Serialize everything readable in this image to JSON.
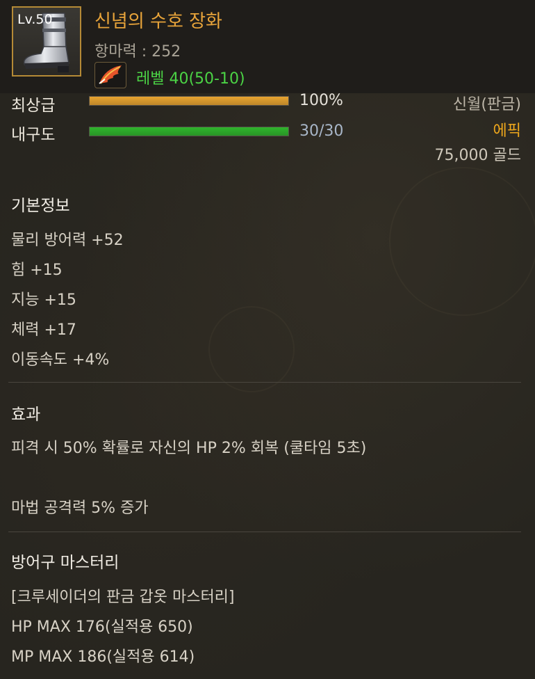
{
  "item": {
    "level_badge": "Lv.50",
    "name": "신념의 수호 장화",
    "resist": "항마력 : 252",
    "required_level": "레벨 40(50-10)",
    "icon": "armored-boots-icon",
    "requirement_icon": "feather-wing-icon"
  },
  "bars": [
    {
      "label": "최상급",
      "value_text": "100%",
      "fill": 1.0,
      "color": "#e8a430",
      "right_text": "신월(판금)",
      "right_color": "#bdb6a8"
    },
    {
      "label": "내구도",
      "value_text": "30/30",
      "fill": 1.0,
      "color": "#2fb52c",
      "right_text": "에픽",
      "right_color": "#f0a81c"
    }
  ],
  "price": "75,000 골드",
  "basic_info": {
    "title": "기본정보",
    "lines": [
      "물리 방어력 +52",
      "힘 +15",
      "지능 +15",
      "체력 +17",
      "이동속도 +4%"
    ]
  },
  "effect": {
    "title": "효과",
    "lines": [
      "피격 시 50% 확률로 자신의 HP 2% 회복 (쿨타임 5초)",
      "마법 공격력 5% 증가"
    ]
  },
  "mastery": {
    "title": "방어구 마스터리",
    "lines": [
      "[크루세이더의 판금 갑옷 마스터리]",
      "HP MAX 176(실적용 650)",
      "MP MAX 186(실적용 614)"
    ]
  },
  "colors": {
    "item_name": "#e8a43a",
    "required_level": "#4bd345",
    "durability_value": "#a8b6c8",
    "grade_value": "#e6e2da",
    "icon_border": "#b58a36"
  }
}
